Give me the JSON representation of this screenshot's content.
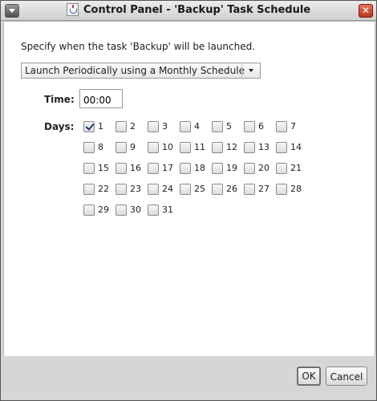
{
  "window": {
    "title": "Control Panel - 'Backup' Task Schedule",
    "close_glyph": "✕"
  },
  "intro": "Specify when the task 'Backup' will be launched.",
  "schedule": {
    "selected": "Launch Periodically using a Monthly Schedule"
  },
  "time": {
    "label": "Time:",
    "value": "00:00"
  },
  "days": {
    "label": "Days:",
    "items": [
      {
        "n": "1",
        "checked": true
      },
      {
        "n": "2",
        "checked": false
      },
      {
        "n": "3",
        "checked": false
      },
      {
        "n": "4",
        "checked": false
      },
      {
        "n": "5",
        "checked": false
      },
      {
        "n": "6",
        "checked": false
      },
      {
        "n": "7",
        "checked": false
      },
      {
        "n": "8",
        "checked": false
      },
      {
        "n": "9",
        "checked": false
      },
      {
        "n": "10",
        "checked": false
      },
      {
        "n": "11",
        "checked": false
      },
      {
        "n": "12",
        "checked": false
      },
      {
        "n": "13",
        "checked": false
      },
      {
        "n": "14",
        "checked": false
      },
      {
        "n": "15",
        "checked": false
      },
      {
        "n": "16",
        "checked": false
      },
      {
        "n": "17",
        "checked": false
      },
      {
        "n": "18",
        "checked": false
      },
      {
        "n": "19",
        "checked": false
      },
      {
        "n": "20",
        "checked": false
      },
      {
        "n": "21",
        "checked": false
      },
      {
        "n": "22",
        "checked": false
      },
      {
        "n": "23",
        "checked": false
      },
      {
        "n": "24",
        "checked": false
      },
      {
        "n": "25",
        "checked": false
      },
      {
        "n": "26",
        "checked": false
      },
      {
        "n": "27",
        "checked": false
      },
      {
        "n": "28",
        "checked": false
      },
      {
        "n": "29",
        "checked": false
      },
      {
        "n": "30",
        "checked": false
      },
      {
        "n": "31",
        "checked": false
      }
    ]
  },
  "buttons": {
    "ok": "OK",
    "cancel": "Cancel"
  }
}
